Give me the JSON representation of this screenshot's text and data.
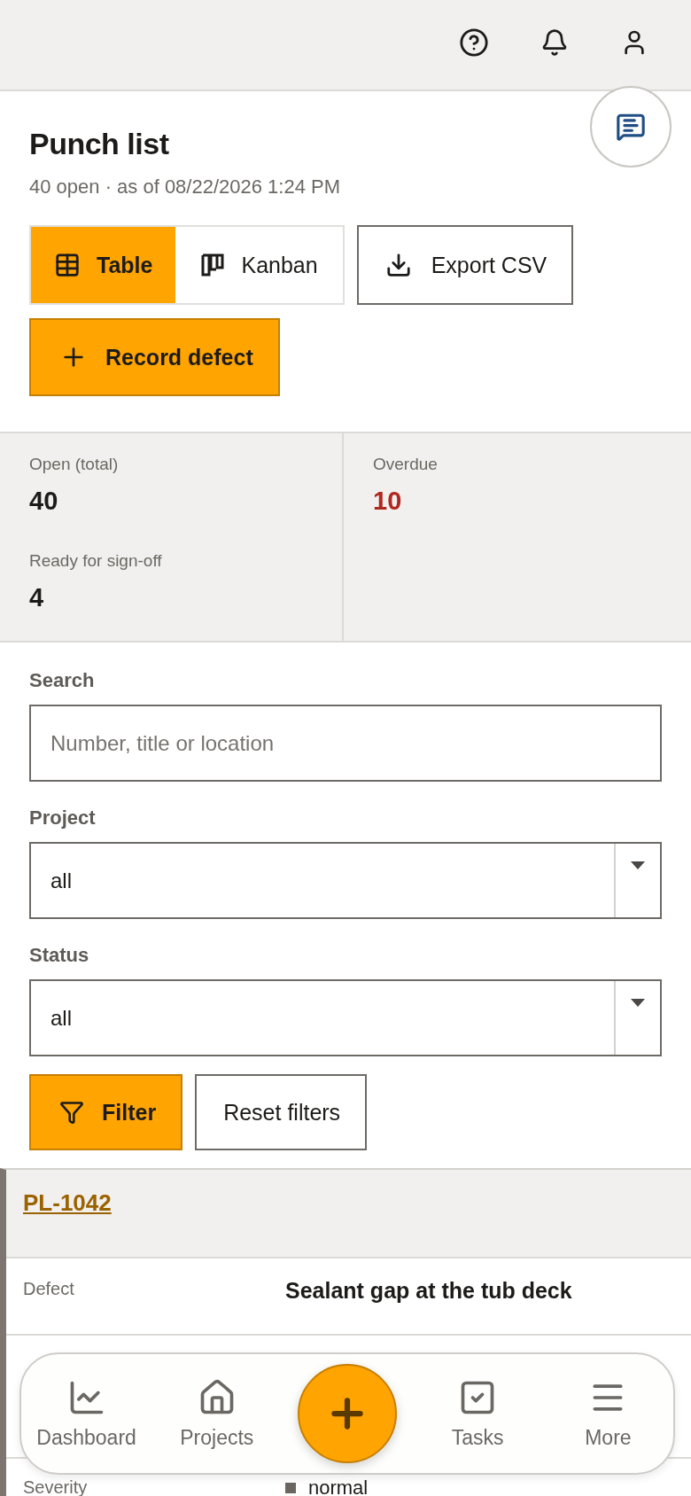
{
  "header": {
    "title": "Punch list",
    "subtitle": "40 open · as of 08/22/2026 1:24 PM"
  },
  "views": [
    {
      "label": "Table",
      "kind": "table",
      "selected": true
    },
    {
      "label": "Kanban",
      "kind": "kanban",
      "selected": false
    }
  ],
  "export_button": "Export CSV",
  "record_button": "Record defect",
  "stats": [
    {
      "label": "Open (total)",
      "value": "40",
      "alert": false
    },
    {
      "label": "Overdue",
      "value": "10",
      "alert": true
    },
    {
      "label": "Ready for sign-off",
      "value": "4",
      "alert": false
    }
  ],
  "filters": {
    "search": {
      "label": "Search",
      "placeholder": "Number, title or location"
    },
    "selects": [
      {
        "label": "Project",
        "value": "all"
      },
      {
        "label": "Status",
        "value": "all"
      }
    ],
    "apply_button": "Filter",
    "reset_button": "Reset filters"
  },
  "card": {
    "number": "PL-1042",
    "rows": [
      {
        "label": "Defect",
        "value": "Sealant gap at the tub deck",
        "kind": "title"
      },
      {
        "kind": "hidden"
      },
      {
        "label": "Severity",
        "value": "normal",
        "kind": "badge",
        "color": "#6b6760"
      }
    ]
  },
  "nav": [
    {
      "label": "Dashboard",
      "kind": "chart"
    },
    {
      "label": "Projects",
      "kind": "home"
    },
    {
      "kind": "add"
    },
    {
      "label": "Tasks",
      "kind": "tasks"
    },
    {
      "label": "More",
      "kind": "menu"
    }
  ]
}
